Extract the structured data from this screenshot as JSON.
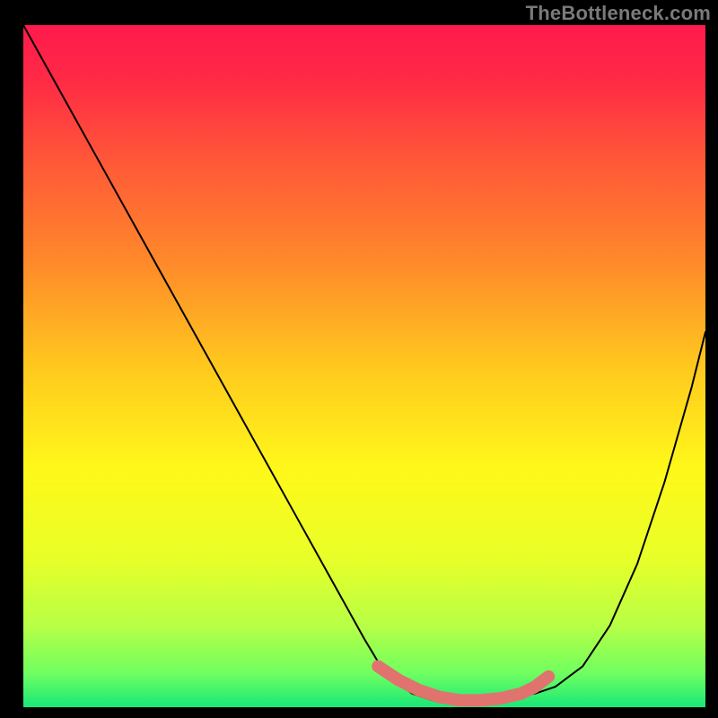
{
  "watermark": "TheBottleneck.com",
  "colors": {
    "background": "#000000",
    "gradient_stops": [
      {
        "offset": 0.0,
        "color": "#ff1a4d"
      },
      {
        "offset": 0.08,
        "color": "#ff2a45"
      },
      {
        "offset": 0.2,
        "color": "#ff5838"
      },
      {
        "offset": 0.35,
        "color": "#ff8a2a"
      },
      {
        "offset": 0.5,
        "color": "#ffc81e"
      },
      {
        "offset": 0.65,
        "color": "#fff81a"
      },
      {
        "offset": 0.78,
        "color": "#e8ff28"
      },
      {
        "offset": 0.88,
        "color": "#b8ff45"
      },
      {
        "offset": 0.95,
        "color": "#70ff60"
      },
      {
        "offset": 1.0,
        "color": "#18e878"
      }
    ],
    "curve": "#000000",
    "marker": "#e1736f"
  },
  "chart_data": {
    "type": "line",
    "title": "",
    "xlabel": "",
    "ylabel": "",
    "xlim": [
      0,
      100
    ],
    "ylim": [
      0,
      100
    ],
    "series": [
      {
        "name": "bottleneck-curve",
        "x": [
          0,
          5,
          10,
          15,
          20,
          25,
          30,
          35,
          40,
          45,
          50,
          53,
          57,
          60,
          63,
          67,
          72,
          75,
          78,
          82,
          86,
          90,
          94,
          98,
          100
        ],
        "values": [
          100,
          91,
          82,
          73,
          64,
          55,
          46,
          37,
          28,
          19,
          10,
          5,
          2,
          1,
          1,
          1,
          1.5,
          2,
          3,
          6,
          12,
          21,
          33,
          47,
          55
        ]
      }
    ],
    "markers": {
      "name": "optimal-range",
      "x": [
        52,
        55,
        58,
        61,
        64,
        67,
        70,
        73,
        75,
        77
      ],
      "values": [
        6,
        4,
        2.5,
        1.5,
        1,
        1,
        1.3,
        2,
        3,
        4.5
      ]
    }
  }
}
